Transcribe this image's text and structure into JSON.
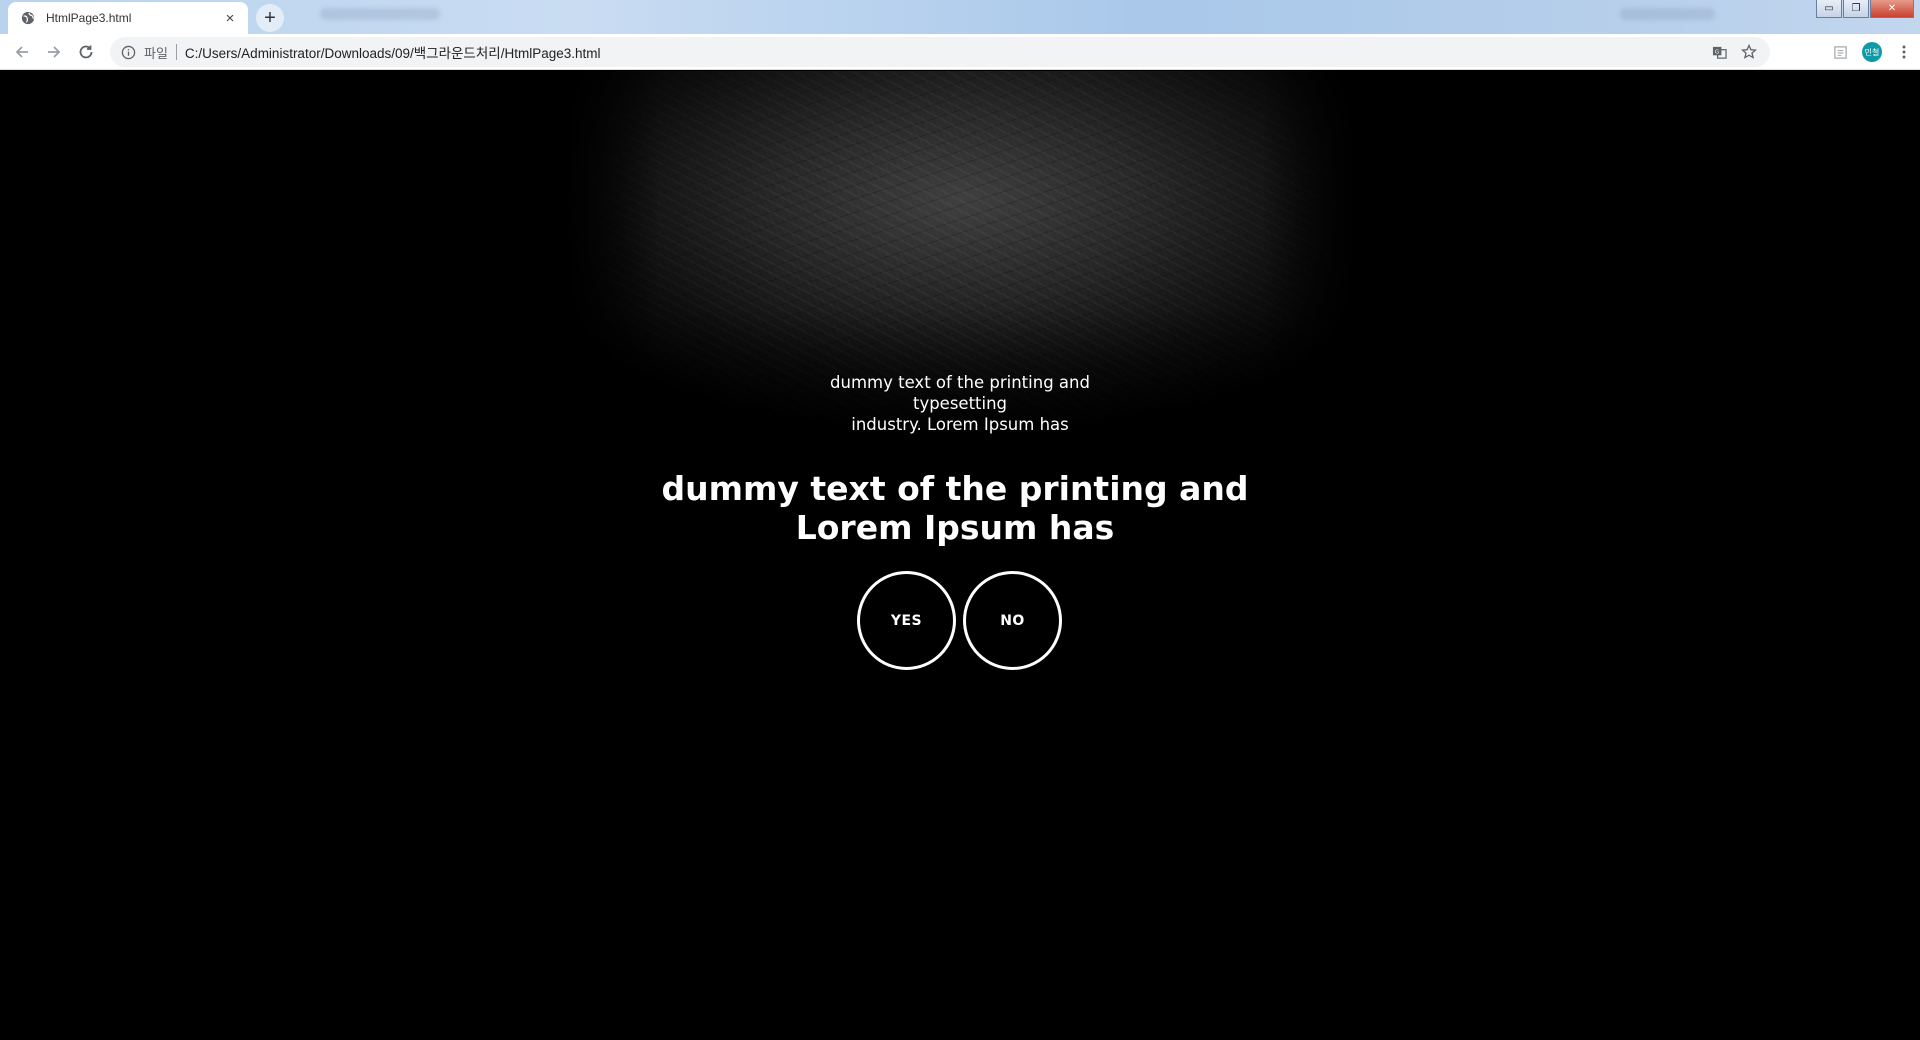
{
  "browser": {
    "tab": {
      "title": "HtmlPage3.html",
      "close_glyph": "×"
    },
    "new_tab_glyph": "+",
    "window_controls": {
      "minimize": "▭",
      "maximize": "❐",
      "close": "✕"
    },
    "omnibox": {
      "scheme_label": "파일",
      "url": "C:/Users/Administrator/Downloads/09/백그라운드처리/HtmlPage3.html"
    },
    "avatar_label": "민철"
  },
  "page": {
    "small_text_lines": [
      "dummy text of the printing and",
      "typesetting",
      "industry. Lorem Ipsum has"
    ],
    "headline_lines": [
      "dummy text of the printing and",
      "Lorem Ipsum has"
    ],
    "yes_label": "YES",
    "no_label": "NO"
  },
  "colors": {
    "background": "#000000",
    "text": "#ffffff",
    "avatar": "#0e9aa7"
  }
}
